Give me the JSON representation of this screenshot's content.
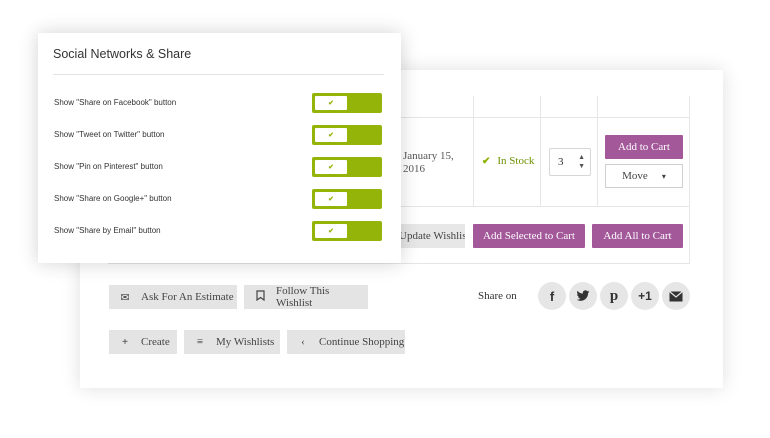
{
  "panel": {
    "title": "Social Networks & Share",
    "options": [
      {
        "label": "Show \"Share on Facebook\" button",
        "enabled": true
      },
      {
        "label": "Show \"Tweet on Twitter\" button",
        "enabled": true
      },
      {
        "label": "Show \"Pin on Pinterest\" button",
        "enabled": true
      },
      {
        "label": "Show \"Share on Google+\" button",
        "enabled": true
      },
      {
        "label": "Show \"Share by Email\" button",
        "enabled": true
      }
    ],
    "toggle_check": "✔"
  },
  "table": {
    "date": "January 15, 2016",
    "stock_icon": "✔",
    "stock_text": "In Stock",
    "quantity": "3",
    "add_to_cart": "Add to Cart",
    "move_label": "Move",
    "move_chevron": "⌄"
  },
  "actions": {
    "update_wishlist": "Update Wishlist",
    "add_selected": "Add Selected to Cart",
    "add_all": "Add All to Cart",
    "ask_estimate": "Ask For An Estimate",
    "follow": "Follow This Wishlist",
    "share_on": "Share on",
    "create": "Create",
    "my_wishlists": "My Wishlists",
    "continue_shopping": "Continue Shopping"
  },
  "social": [
    {
      "name": "facebook-icon",
      "glyph": "f"
    },
    {
      "name": "twitter-icon",
      "glyph": "🐦"
    },
    {
      "name": "pinterest-icon",
      "glyph": "p"
    },
    {
      "name": "google-plus-icon",
      "glyph": "+1"
    },
    {
      "name": "email-icon",
      "glyph": "✉"
    }
  ],
  "colors": {
    "accent_purple": "#a3589a",
    "toggle_green": "#95b40a",
    "stock_green": "#6c8e00"
  }
}
